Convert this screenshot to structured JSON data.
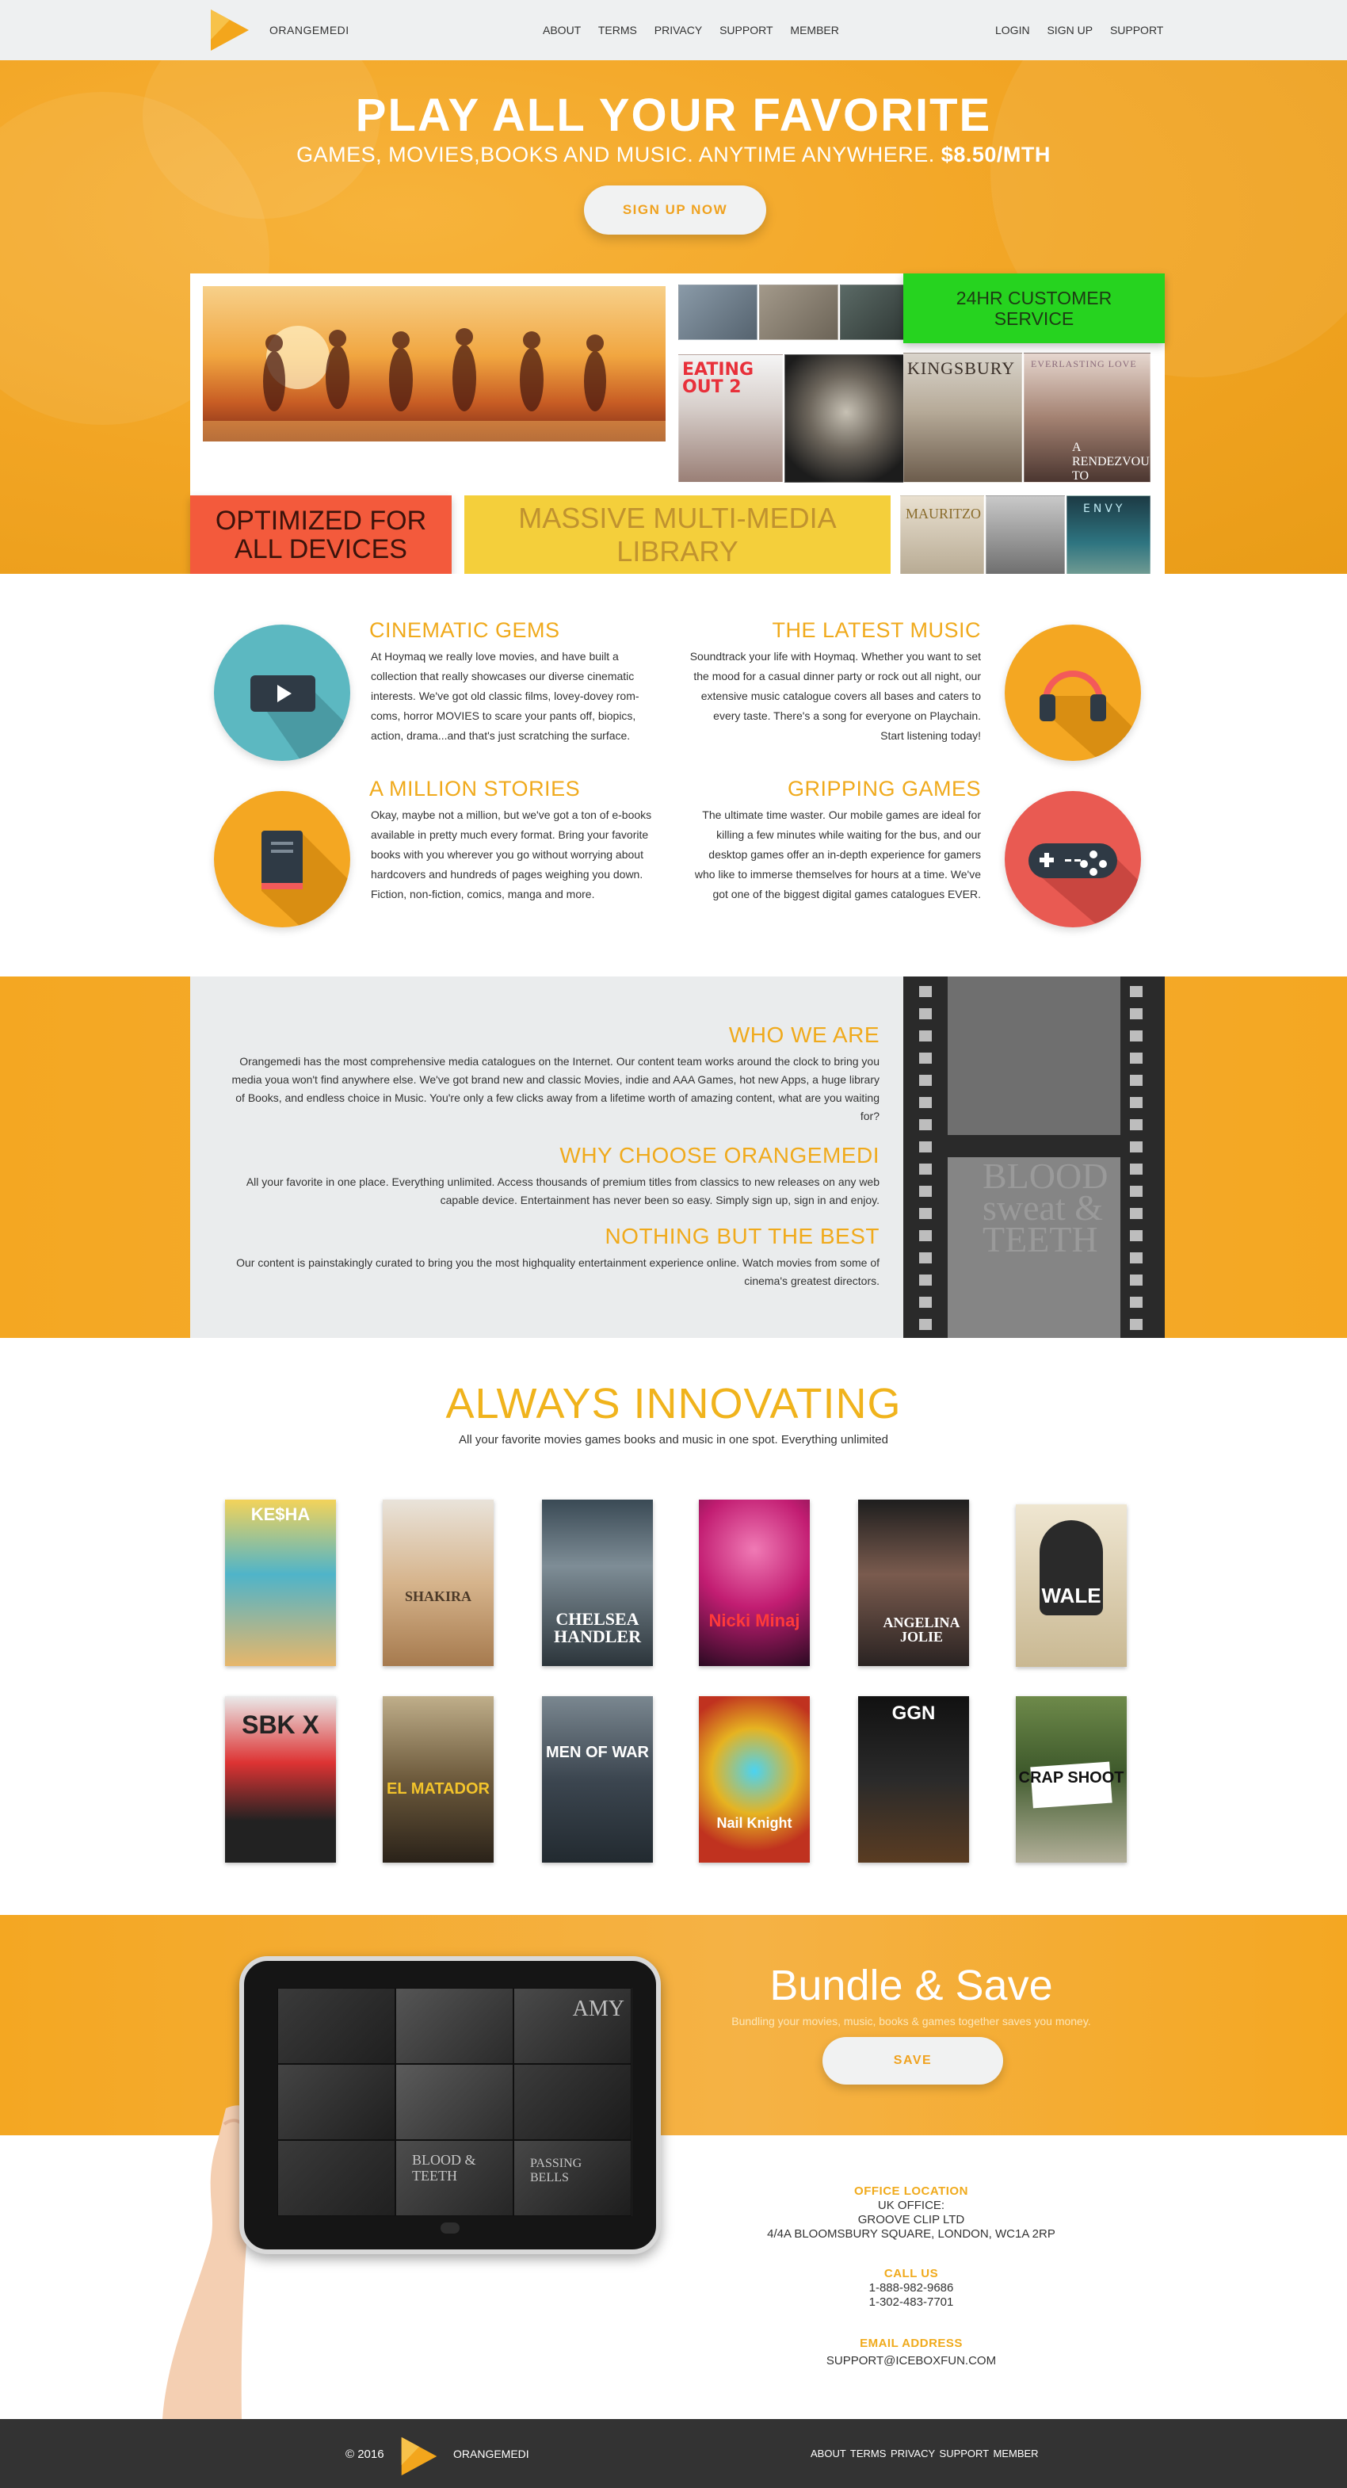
{
  "nav": {
    "brand": "ORANGEMEDI",
    "center_links": [
      "ABOUT",
      "TERMS",
      "PRIVACY",
      "SUPPORT",
      "MEMBER"
    ],
    "right_links": [
      "LOGIN",
      "SIGN UP",
      "SUPPORT"
    ]
  },
  "hero": {
    "title": "PLAY ALL YOUR FAVORITE",
    "subtitle": "GAMES, MOVIES,BOOKS AND MUSIC. ANYTIME ANYWHERE.",
    "price": "$8.50/MTH",
    "cta": "SIGN UP NOW"
  },
  "collage": {
    "customer_service": "24HR CUSTOMER SERVICE",
    "optimized": "OPTIMIZED FOR ALL DEVICES",
    "library": "MASSIVE MULTI-MEDIA LIBRARY",
    "posters": [
      "EATING OUT 2",
      "KINGSBURY",
      "EVERLASTING LOVE",
      "A RENDEZVOUS TO REMEMBER",
      "MAURITZO",
      "ENVY"
    ]
  },
  "features": {
    "movies": {
      "title": "CINEMATIC GEMS",
      "text": "At Hoymaq we really love movies, and have built a collection that really showcases our diverse cinematic interests. We've got old classic films, lovey-dovey rom-coms, horror MOVIES to scare your pants off, biopics, action, drama...and that's just scratching the surface."
    },
    "music": {
      "title": "THE LATEST MUSIC",
      "text": "Soundtrack your life with Hoymaq. Whether you want to set the mood for a casual dinner party or rock out all night, our extensive music catalogue covers all bases and caters to every taste. There's a song for everyone on Playchain. Start listening today!"
    },
    "books": {
      "title": "A MILLION STORIES",
      "text": "Okay, maybe not a million, but we've got a ton of e-books available in pretty much every format. Bring your favorite books with you wherever you go without worrying about hardcovers and hundreds of pages weighing you down. Fiction, non-fiction, comics, manga and more."
    },
    "games": {
      "title": "GRIPPING GAMES",
      "text": "The ultimate time waster. Our mobile games are ideal for killing a few minutes while waiting for the bus, and our desktop games offer an in-depth experience for gamers who like to immerse themselves for hours at a time. We've got one of the biggest digital games catalogues EVER."
    }
  },
  "about": {
    "who_title": "WHO WE ARE",
    "who_text": "Orangemedi has the most comprehensive media catalogues on the Internet. Our content team works around the clock to bring you media youa won't find anywhere else. We've got brand new and classic Movies, indie and AAA Games, hot new Apps, a huge library of Books, and endless choice in Music. You're only a few clicks away from a lifetime worth of amazing content, what are you waiting for?",
    "why_title": "WHY CHOOSE ORANGEMEDI",
    "why_text": "All your favorite in one place. Everything unlimited. Access thousands of premium titles from classics to new releases on any web capable device. Entertainment has never been so easy. Simply sign up, sign in and enjoy.",
    "best_title": "NOTHING BUT THE BEST",
    "best_text": "Our content is painstakingly curated to bring you the most highquality entertainment experience online. Watch movies from some of cinema's greatest directors.",
    "film_text": "BLOOD sweat & TEETH"
  },
  "innovating": {
    "title": "ALWAYS INNOVATING",
    "subtitle": "All your favorite movies games books and music in one spot. Everything unlimited",
    "row1": [
      "KE$HA",
      "SHAKIRA",
      "CHELSEA HANDLER",
      "Nicki Minaj",
      "ANGELINA JOLIE",
      "WALE"
    ],
    "row2": [
      "SBK X",
      "EL MATADOR",
      "MEN OF WAR",
      "Nail Knight",
      "GGN",
      "CRAP SHOOT"
    ]
  },
  "bundle": {
    "title": "Bundle & Save",
    "subtitle": "Bundling your movies, music, books & games together saves you money.",
    "button": "SAVE",
    "tablet_titles": [
      "AMY",
      "BLOOD & TEETH",
      "PASSING BELLS"
    ]
  },
  "contact": {
    "office_label": "OFFICE LOCATION",
    "office_lines": [
      "UK OFFICE:",
      "GROOVE CLIP LTD",
      "4/4A BLOOMSBURY SQUARE, LONDON, WC1A 2RP"
    ],
    "call_label": "CALL US",
    "phones": [
      "1-888-982-9686",
      "1-302-483-7701"
    ],
    "email_label": "EMAIL ADDRESS",
    "email": "SUPPORT@ICEBOXFUN.COM"
  },
  "footer": {
    "copyright": "© 2016",
    "brand": "ORANGEMEDI",
    "links": "ABOUT TERMS PRIVACY SUPPORT MEMBER"
  },
  "colors": {
    "accent": "#f0aa1c",
    "orange_bg": "#f4a722",
    "green": "#26d31f",
    "red": "#f35a3c",
    "yellow": "#f4cf3b",
    "footer": "#333333"
  }
}
